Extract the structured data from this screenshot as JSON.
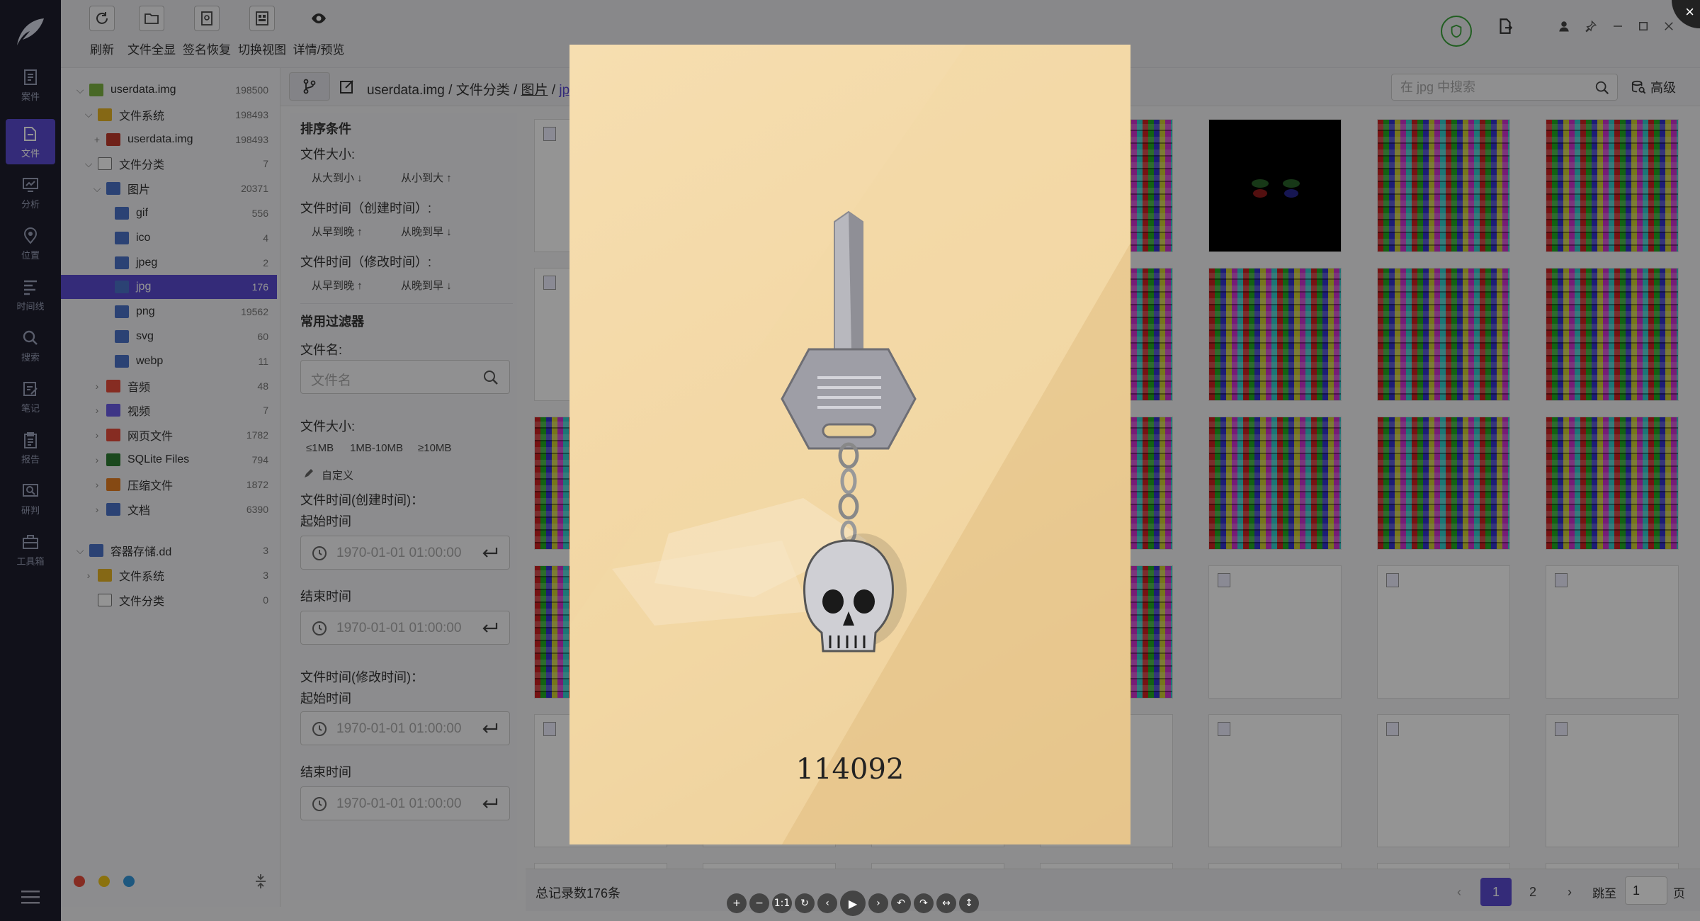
{
  "rail": {
    "items": [
      {
        "label": "案件",
        "icon": "case-icon"
      },
      {
        "label": "文件",
        "icon": "file-icon"
      },
      {
        "label": "分析",
        "icon": "analysis-icon"
      },
      {
        "label": "位置",
        "icon": "location-icon"
      },
      {
        "label": "时间线",
        "icon": "timeline-icon"
      },
      {
        "label": "搜索",
        "icon": "search-icon"
      },
      {
        "label": "笔记",
        "icon": "note-icon"
      },
      {
        "label": "报告",
        "icon": "report-icon"
      },
      {
        "label": "研判",
        "icon": "judge-icon"
      },
      {
        "label": "工具箱",
        "icon": "toolbox-icon"
      }
    ],
    "active_index": 1
  },
  "toolbar": {
    "refresh": "刷新",
    "file_overview": "文件全显",
    "signature_recovery": "签名恢复",
    "switch_view": "切换视图",
    "details_preview": "详情/预览"
  },
  "tree": {
    "nodes": [
      {
        "label": "userdata.img",
        "count": "198500",
        "level": 0,
        "arrow": "⌵",
        "icon": "android-icon"
      },
      {
        "label": "文件系统",
        "count": "198493",
        "level": 1,
        "arrow": "⌵",
        "icon": "folder-icon"
      },
      {
        "label": "userdata.img",
        "count": "198493",
        "level": 2,
        "arrow": "+",
        "icon": "image-file-icon"
      },
      {
        "label": "文件分类",
        "count": "7",
        "level": 1,
        "arrow": "⌵",
        "icon": "document-icon"
      },
      {
        "label": "图片",
        "count": "20371",
        "level": 2,
        "arrow": "⌵",
        "icon": "picture-icon"
      },
      {
        "label": "gif",
        "count": "556",
        "level": 3,
        "arrow": "",
        "icon": "picture-icon"
      },
      {
        "label": "ico",
        "count": "4",
        "level": 3,
        "arrow": "",
        "icon": "picture-icon"
      },
      {
        "label": "jpeg",
        "count": "2",
        "level": 3,
        "arrow": "",
        "icon": "picture-icon"
      },
      {
        "label": "jpg",
        "count": "176",
        "level": 3,
        "arrow": "",
        "icon": "picture-icon",
        "selected": true
      },
      {
        "label": "png",
        "count": "19562",
        "level": 3,
        "arrow": "",
        "icon": "picture-icon"
      },
      {
        "label": "svg",
        "count": "60",
        "level": 3,
        "arrow": "",
        "icon": "picture-icon"
      },
      {
        "label": "webp",
        "count": "11",
        "level": 3,
        "arrow": "",
        "icon": "picture-icon"
      },
      {
        "label": "音频",
        "count": "48",
        "level": 2,
        "arrow": "›",
        "icon": "audio-icon"
      },
      {
        "label": "视频",
        "count": "7",
        "level": 2,
        "arrow": "›",
        "icon": "video-icon"
      },
      {
        "label": "网页文件",
        "count": "1782",
        "level": 2,
        "arrow": "›",
        "icon": "web-file-icon"
      },
      {
        "label": "SQLite Files",
        "count": "794",
        "level": 2,
        "arrow": "›",
        "icon": "database-icon"
      },
      {
        "label": "压缩文件",
        "count": "1872",
        "level": 2,
        "arrow": "›",
        "icon": "archive-icon"
      },
      {
        "label": "文档",
        "count": "6390",
        "level": 2,
        "arrow": "›",
        "icon": "doc-icon"
      },
      {
        "label": "容器存储.dd",
        "count": "3",
        "level": 0,
        "arrow": "⌵",
        "icon": "disk-icon"
      },
      {
        "label": "文件系统",
        "count": "3",
        "level": 1,
        "arrow": "›",
        "icon": "folder-icon"
      },
      {
        "label": "文件分类",
        "count": "0",
        "level": 1,
        "arrow": "",
        "icon": "document-icon"
      }
    ]
  },
  "breadcrumb": {
    "root": "userdata.img",
    "sep": " / ",
    "c1": "文件分类",
    "c2": "图片",
    "current": "jpg"
  },
  "search": {
    "placeholder": "在 jpg 中搜索"
  },
  "advanced_label": "高级",
  "filters": {
    "sort_title": "排序条件",
    "size_label": "文件大小:",
    "size_desc": "从大到小 ↓",
    "size_asc": "从小到大 ↑",
    "ctime_label": "文件时间（创建时间）:",
    "ctime_asc": "从早到晚 ↑",
    "ctime_desc": "从晚到早 ↓",
    "mtime_label": "文件时间（修改时间）:",
    "mtime_asc": "从早到晚 ↑",
    "mtime_desc": "从晚到早 ↓",
    "common_title": "常用过滤器",
    "filename_label": "文件名:",
    "filename_placeholder": "文件名",
    "size2_label": "文件大小:",
    "size_opt1": "≤1MB",
    "size_opt2": "1MB-10MB",
    "size_opt3": "≥10MB",
    "custom": "自定义",
    "ctime2_label": "文件时间(创建时间)：",
    "start_label": "起始时间",
    "end_label": "结束时间",
    "mtime2_label": "文件时间(修改时间)：",
    "start2_label": "起始时间",
    "end2_label": "结束时间",
    "datetime_value": "1970-01-01 01:00:00"
  },
  "status": {
    "total": "总记录数176条",
    "pages": [
      "1",
      "2"
    ],
    "current_page": "1",
    "jump_label": "跳至",
    "jump_value": "1",
    "page_suffix": "页"
  },
  "preview": {
    "code": "114092"
  },
  "viewer_controls": [
    "+",
    "−",
    "1:1",
    "↻",
    "‹",
    "▶",
    "›",
    "↶",
    "↷",
    "↔",
    "↕"
  ],
  "colors": {
    "accent": "#5b4bd0",
    "rail": "#1e1e2e",
    "shield": "#3aa33a"
  }
}
